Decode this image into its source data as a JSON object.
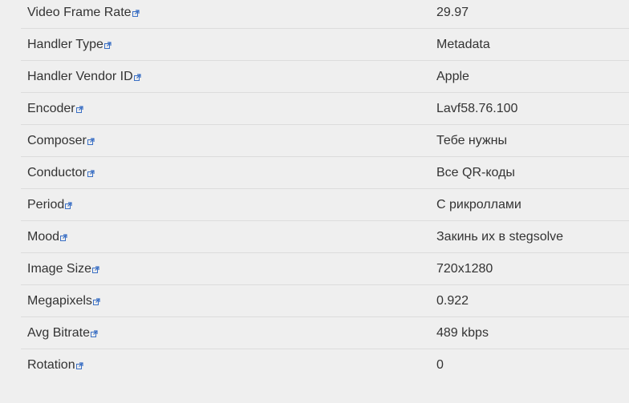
{
  "rows": [
    {
      "key": "Video Frame Rate",
      "value": "29.97"
    },
    {
      "key": "Handler Type",
      "value": "Metadata"
    },
    {
      "key": "Handler Vendor ID",
      "value": "Apple"
    },
    {
      "key": "Encoder",
      "value": "Lavf58.76.100"
    },
    {
      "key": "Composer",
      "value": "Тебе нужны"
    },
    {
      "key": "Conductor",
      "value": "Все QR-коды"
    },
    {
      "key": "Period",
      "value": "С рикроллами"
    },
    {
      "key": "Mood",
      "value": "Закинь их в stegsolve"
    },
    {
      "key": "Image Size",
      "value": "720x1280"
    },
    {
      "key": "Megapixels",
      "value": "0.922"
    },
    {
      "key": "Avg Bitrate",
      "value": "489 kbps"
    },
    {
      "key": "Rotation",
      "value": "0"
    }
  ],
  "icons": {
    "link": "external-link-icon"
  },
  "colors": {
    "link_icon": "#3a6fc4",
    "text": "#333333",
    "divider": "#dcdcdc",
    "background": "#efefef"
  }
}
